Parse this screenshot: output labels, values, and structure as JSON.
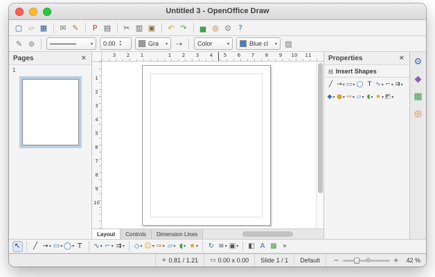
{
  "window": {
    "title": "Untitled 3 - OpenOffice Draw"
  },
  "glyphs": {
    "caret": "▾",
    "spin_up": "▴",
    "spin_down": "▾",
    "close": "×"
  },
  "toolbars": {
    "standard": [
      {
        "name": "new-document",
        "glyph": "▢",
        "color": "#2a5b9e"
      },
      {
        "name": "open-document",
        "glyph": "▱",
        "color": "#d9a23c"
      },
      {
        "name": "save-document",
        "glyph": "▦",
        "color": "#2a5b9e"
      },
      {
        "sep": true
      },
      {
        "name": "email-document",
        "glyph": "✉",
        "color": "#707070"
      },
      {
        "name": "edit-file",
        "glyph": "✎",
        "color": "#b07a2e"
      },
      {
        "sep": true
      },
      {
        "name": "export-pdf",
        "glyph": "P",
        "color": "#c0392b"
      },
      {
        "name": "print-file",
        "glyph": "▤",
        "color": "#606060"
      },
      {
        "sep": true
      },
      {
        "name": "cut",
        "glyph": "✂",
        "color": "#606060"
      },
      {
        "name": "copy",
        "glyph": "▥",
        "color": "#606060"
      },
      {
        "name": "paste",
        "glyph": "▣",
        "color": "#8a6d3b"
      },
      {
        "sep": true
      },
      {
        "name": "undo",
        "glyph": "↶",
        "color": "#d1a327"
      },
      {
        "name": "redo",
        "glyph": "↷",
        "color": "#6f9e3f"
      },
      {
        "sep": true
      },
      {
        "name": "insert-chart",
        "glyph": "▅",
        "color": "#4a9e4a"
      },
      {
        "name": "navigator",
        "glyph": "◎",
        "color": "#c46a1f"
      },
      {
        "name": "zoom",
        "glyph": "⊙",
        "color": "#555555"
      },
      {
        "name": "help",
        "glyph": "?",
        "color": "#2a6bd8"
      }
    ],
    "line_filling": {
      "edit_points_glyph": "✎",
      "glue_points_glyph": "⊚",
      "line_width_value": "0.00",
      "line_color_value": "Gra",
      "arrow_style_glyph": "⇢",
      "area_style_value": "Color",
      "area_color_value": "Blue cl",
      "area_color_hex": "#4a7ebb",
      "shadow_glyph": "▨"
    },
    "drawing": [
      {
        "name": "select",
        "glyph": "↖",
        "color": "#333333",
        "cls": "pressed"
      },
      {
        "sep": true
      },
      {
        "name": "line",
        "glyph": "╱",
        "color": "#333333"
      },
      {
        "name": "line-ends-with-arrow",
        "glyph": "→",
        "color": "#333333",
        "caret": "▾"
      },
      {
        "name": "rectangle",
        "glyph": "▭",
        "color": "#3a6ea5",
        "caret": "▾"
      },
      {
        "name": "ellipse",
        "glyph": "◯",
        "color": "#3a6ea5",
        "caret": "▾"
      },
      {
        "name": "text",
        "glyph": "T",
        "color": "#333333"
      },
      {
        "sep": true
      },
      {
        "name": "curve",
        "glyph": "∿",
        "color": "#3a6ea5",
        "caret": "▾"
      },
      {
        "name": "connector",
        "glyph": "⌐",
        "color": "#3a6ea5",
        "caret": "▾"
      },
      {
        "name": "lines-and-arrows",
        "glyph": "⇉",
        "color": "#333333",
        "caret": "▾"
      },
      {
        "sep": true
      },
      {
        "name": "basic-shapes",
        "glyph": "◇",
        "color": "#3a6ea5",
        "caret": "▾"
      },
      {
        "name": "symbol-shapes",
        "glyph": "☺",
        "color": "#d1a327",
        "caret": "▾"
      },
      {
        "name": "block-arrows",
        "glyph": "⇨",
        "color": "#c46a1f",
        "caret": "▾"
      },
      {
        "name": "flowchart",
        "glyph": "▱",
        "color": "#4a7ebb",
        "caret": "▾"
      },
      {
        "name": "callouts",
        "glyph": "◖",
        "color": "#4a9e4a",
        "caret": "▾"
      },
      {
        "name": "stars",
        "glyph": "★",
        "color": "#d1a327",
        "caret": "▾"
      },
      {
        "sep": true
      },
      {
        "name": "rotate",
        "glyph": "↻",
        "color": "#3a6ea5"
      },
      {
        "name": "align-objects",
        "glyph": "≡",
        "color": "#555555",
        "caret": "▾"
      },
      {
        "name": "arrange",
        "glyph": "▣",
        "color": "#555555",
        "caret": "▾"
      },
      {
        "sep": true
      },
      {
        "name": "extrusion",
        "glyph": "◧",
        "color": "#555555"
      },
      {
        "name": "fontwork",
        "glyph": "A",
        "color": "#3a6ea5"
      },
      {
        "name": "insert-image",
        "glyph": "▩",
        "color": "#4a9e4a"
      },
      {
        "name": "toolbar-overflow",
        "glyph": "»",
        "color": "#555555"
      }
    ]
  },
  "pages_panel": {
    "title": "Pages",
    "page_number": "1"
  },
  "properties_panel": {
    "title": "Properties",
    "section_glyph": "⊟",
    "section_title": "Insert Shapes",
    "row1": [
      {
        "name": "line",
        "glyph": "╱",
        "color": "#333333"
      },
      {
        "name": "line-ends-with-arrow",
        "glyph": "→",
        "color": "#333333",
        "caret": "▾"
      },
      {
        "name": "rectangle",
        "glyph": "▭",
        "color": "#3a6ea5",
        "caret": "▾"
      },
      {
        "name": "ellipse",
        "glyph": "◯",
        "color": "#3a6ea5"
      },
      {
        "name": "text",
        "glyph": "T",
        "color": "#333333"
      },
      {
        "name": "curve",
        "glyph": "∿",
        "color": "#3a6ea5",
        "caret": "▾"
      },
      {
        "name": "connector",
        "glyph": "⌐",
        "color": "#3a6ea5",
        "caret": "▾"
      },
      {
        "name": "lines-and-arrows",
        "glyph": "⇉",
        "color": "#333333",
        "caret": "▾"
      }
    ],
    "row2": [
      {
        "name": "basic-shapes",
        "glyph": "◆",
        "color": "#3a6ea5",
        "caret": "▾"
      },
      {
        "name": "symbol-shapes",
        "glyph": "●",
        "color": "#d1a327",
        "caret": "▾"
      },
      {
        "name": "block-arrows",
        "glyph": "⇨",
        "color": "#c46a1f",
        "caret": "▾"
      },
      {
        "name": "flowchart",
        "glyph": "▱",
        "color": "#4a7ebb",
        "caret": "▾"
      },
      {
        "name": "callouts",
        "glyph": "◖",
        "color": "#4a9e4a",
        "caret": "▾"
      },
      {
        "name": "stars",
        "glyph": "★",
        "color": "#d1a327",
        "caret": "▾"
      },
      {
        "name": "3d-objects",
        "glyph": "◩",
        "color": "#888888",
        "caret": "▾"
      }
    ]
  },
  "decks": [
    {
      "name": "properties-deck",
      "glyph": "⚙",
      "color": "#3b6fb5"
    },
    {
      "name": "styles-deck",
      "glyph": "◆",
      "color": "#8a5fb0"
    },
    {
      "name": "gallery-deck",
      "glyph": "▦",
      "color": "#3f9b4f"
    },
    {
      "name": "navigator-deck",
      "glyph": "◎",
      "color": "#d9792a"
    }
  ],
  "rulers": {
    "horizontal": [
      {
        "label": "3"
      },
      {
        "label": "2"
      },
      {
        "label": "1"
      },
      {
        "label": ""
      },
      {
        "label": "1"
      },
      {
        "label": "2"
      },
      {
        "label": "3"
      },
      {
        "label": "4"
      },
      {
        "label": "5"
      },
      {
        "label": "6"
      },
      {
        "label": "7"
      },
      {
        "label": "8"
      },
      {
        "label": "9"
      },
      {
        "label": "10"
      },
      {
        "label": "11"
      }
    ],
    "vertical": [
      {
        "label": "1"
      },
      {
        "label": "2"
      },
      {
        "label": "3"
      },
      {
        "label": "4"
      },
      {
        "label": "5"
      },
      {
        "label": "6"
      },
      {
        "label": "7"
      },
      {
        "label": "8"
      },
      {
        "label": "9"
      },
      {
        "label": "10"
      }
    ]
  },
  "tabs": [
    {
      "id": "layout",
      "label": "Layout",
      "cls": "active"
    },
    {
      "id": "controls",
      "label": "Controls",
      "cls": ""
    },
    {
      "id": "dimension-lines",
      "label": "Dimension Lines",
      "cls": ""
    }
  ],
  "status": {
    "position": "0.81 / 1.21",
    "size": "0.00 x 0.00",
    "slide": "Slide 1 / 1",
    "style": "Default",
    "zoom_out": "−",
    "zoom_in": "+",
    "zoom": "42 %"
  }
}
